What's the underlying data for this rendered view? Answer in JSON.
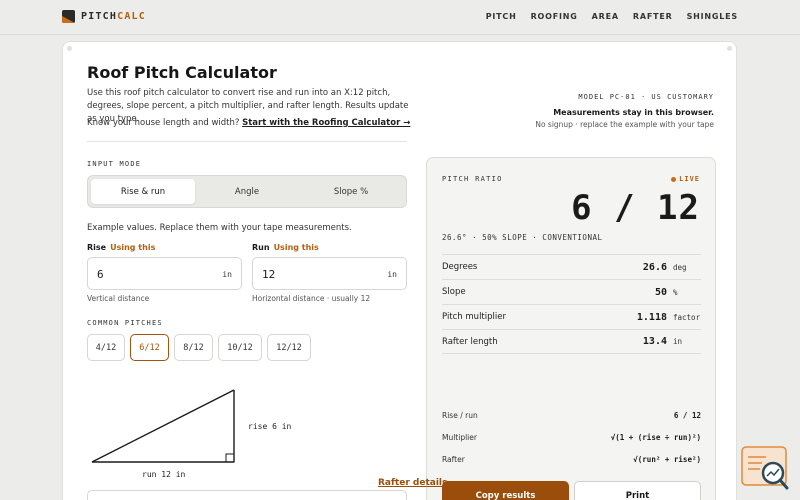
{
  "brand": {
    "prefix": "PITCH",
    "accent": "CALC"
  },
  "nav": [
    "PITCH",
    "ROOFING",
    "AREA",
    "RAFTER",
    "SHINGLES"
  ],
  "header": {
    "title": "Roof Pitch Calculator",
    "description": "Use this roof pitch calculator to convert rise and run into an X:12 pitch, degrees, slope percent, a pitch multiplier, and rafter length. Results update as you type.",
    "house_prefix": "Know your house length and width?",
    "house_link": "Start with the Roofing Calculator →",
    "model": "MODEL PC-01 · US CUSTOMARY",
    "measurements_note": "Measurements stay in this browser.",
    "nosignup": "No signup · replace the example with your tape"
  },
  "input_mode": {
    "label": "INPUT MODE",
    "options": [
      "Rise & run",
      "Angle",
      "Slope %"
    ],
    "selected": "Rise & run"
  },
  "example_text": "Example values. Replace them with your tape measurements.",
  "rise": {
    "label": "Rise",
    "tag": "Using this",
    "value": "6",
    "unit": "in",
    "hint": "Vertical distance"
  },
  "run": {
    "label": "Run",
    "tag": "Using this",
    "value": "12",
    "unit": "in",
    "hint": "Horizontal distance · usually 12"
  },
  "common_pitches": {
    "label": "COMMON PITCHES",
    "options": [
      "4/12",
      "6/12",
      "8/12",
      "10/12",
      "12/12"
    ],
    "selected": "6/12"
  },
  "diagram": {
    "rise_label": "rise 6 in",
    "run_label": "run 12 in"
  },
  "results": {
    "label": "PITCH RATIO",
    "live": "LIVE",
    "ratio": "6 / 12",
    "subtitle": "26.6° · 50% SLOPE · CONVENTIONAL",
    "rows": [
      {
        "label": "Degrees",
        "value": "26.6",
        "unit": "deg"
      },
      {
        "label": "Slope",
        "value": "50",
        "unit": "%"
      },
      {
        "label": "Pitch multiplier",
        "value": "1.118",
        "unit": "factor"
      },
      {
        "label": "Rafter length",
        "value": "13.4",
        "unit": "in"
      }
    ],
    "formulas": [
      {
        "label": "Rise / run",
        "value": "6 / 12"
      },
      {
        "label": "Multiplier",
        "value": "√(1 + (rise ÷ run)²)"
      },
      {
        "label": "Rafter",
        "value": "√(run² + rise²)"
      }
    ],
    "copy_label": "Copy results",
    "print_label": "Print",
    "rafter_link": "Rafter details"
  },
  "colors": {
    "accent": "#9b4e0b",
    "accent_light": "#c86e14",
    "background": "#ececea"
  },
  "icons": [
    "logo-icon",
    "live-dot-icon",
    "search-widget-icon"
  ]
}
